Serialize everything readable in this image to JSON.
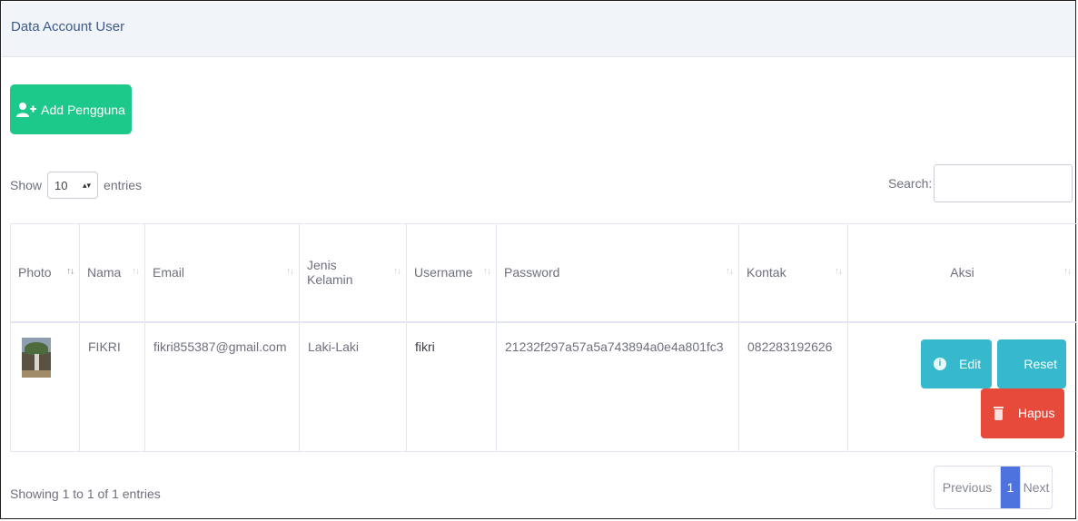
{
  "card": {
    "title": "Data Account User"
  },
  "add_button": {
    "label": "Add Pengguna",
    "icon": "user-plus-icon",
    "color": "#1cc88a"
  },
  "length_menu": {
    "prefix": "Show",
    "value": "10",
    "suffix": "entries"
  },
  "search": {
    "label": "Search:",
    "value": ""
  },
  "table": {
    "columns": [
      {
        "label": "Photo"
      },
      {
        "label": "Nama"
      },
      {
        "label": "Email"
      },
      {
        "label": "Jenis Kelamin",
        "line1": "Jenis",
        "line2": "Kelamin"
      },
      {
        "label": "Username"
      },
      {
        "label": "Password"
      },
      {
        "label": "Kontak"
      },
      {
        "label": "Aksi"
      }
    ],
    "rows": [
      {
        "nama": "FIKRI",
        "email": "fikri855387@gmail.com",
        "jenis_kelamin": "Laki-Laki",
        "username": "fikri",
        "password": "21232f297a57a5a743894a0e4a801fc3",
        "kontak": "082283192626",
        "actions": {
          "edit": "Edit",
          "reset": "Reset",
          "hapus": "Hapus"
        }
      }
    ]
  },
  "footer": {
    "info": "Showing 1 to 1 of 1 entries"
  },
  "pagination": {
    "previous": "Previous",
    "current": "1",
    "next": "Next"
  },
  "colors": {
    "info": "#36b9cc",
    "danger": "#e74a3b",
    "primary": "#4e73df"
  }
}
